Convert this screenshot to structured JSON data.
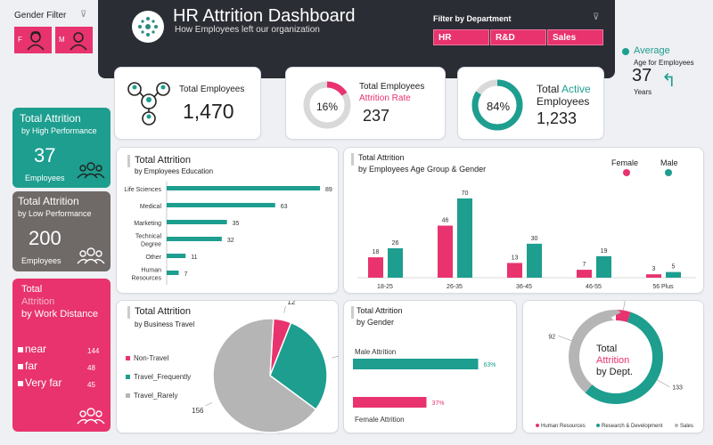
{
  "gender_filter": {
    "label": "Gender Filter",
    "female_letter": "F",
    "male_letter": "M"
  },
  "header": {
    "title": "HR Attrition Dashboard",
    "subtitle": "How Employees left our organization"
  },
  "dept_filter": {
    "label": "Filter by Department",
    "options": [
      "HR",
      "R&D",
      "Sales"
    ]
  },
  "average_age": {
    "label": "Average",
    "sublabel": "Age for Employees",
    "value": "37",
    "unit": "Years"
  },
  "kpis": {
    "total_employees": {
      "label": "Total Employees",
      "value": "1,470"
    },
    "attrition": {
      "label": "Total Employees",
      "label2": "Attrition Rate",
      "pct": "16%",
      "pct_value": 16,
      "value": "237"
    },
    "active": {
      "label_a": "Total",
      "label_b": "Active",
      "label_c": "Employees",
      "pct": "84%",
      "pct_value": 84,
      "value": "1,233"
    }
  },
  "high_perf": {
    "title": "Total Attrition",
    "subtitle": "by High Performance",
    "value": "37",
    "unit": "Employees"
  },
  "low_perf": {
    "title": "Total Attrition",
    "subtitle": "by Low Performance",
    "value": "200",
    "unit": "Employees"
  },
  "work_distance": {
    "title1": "Total",
    "title2": "Attrition",
    "title3": "by Work Distance",
    "items": [
      {
        "label": "near",
        "value": "144"
      },
      {
        "label": "far",
        "value": "48"
      },
      {
        "label": "Very far",
        "value": "45"
      }
    ]
  },
  "education": {
    "title": "Total Attrition",
    "subtitle": "by Employees Education",
    "chart_data": {
      "type": "bar",
      "categories": [
        "Life Sciences",
        "Medical",
        "Marketing",
        "Technical Degree",
        "Other",
        "Human Resources"
      ],
      "values": [
        89,
        63,
        35,
        32,
        11,
        7
      ]
    }
  },
  "age_gender": {
    "title": "Total Attrition",
    "subtitle": "by Employees Age Group & Gender",
    "legend": {
      "female": "Female",
      "male": "Male"
    },
    "chart_data": {
      "type": "bar",
      "categories": [
        "18-25",
        "26-35",
        "36-45",
        "46-55",
        "56 Plus"
      ],
      "series": [
        {
          "name": "Female",
          "values": [
            18,
            46,
            13,
            7,
            3
          ]
        },
        {
          "name": "Male",
          "values": [
            26,
            70,
            30,
            19,
            5
          ]
        }
      ]
    }
  },
  "travel": {
    "title": "Total Attrition",
    "subtitle": "by Business Travel",
    "chart_data": {
      "type": "pie",
      "categories": [
        "Non-Travel",
        "Travel_Frequently",
        "Travel_Rarely"
      ],
      "values": [
        12,
        69,
        156
      ]
    }
  },
  "gender": {
    "title": "Total Attrition",
    "subtitle": "by Gender",
    "chart_data": {
      "type": "bar",
      "categories": [
        "Male Attrition",
        "Female Attrition"
      ],
      "values": [
        63,
        37
      ],
      "labels": [
        "63%",
        "37%"
      ]
    }
  },
  "dept": {
    "center1": "Total",
    "center2": "Attrition",
    "center3": "by Dept.",
    "chart_data": {
      "type": "pie",
      "categories": [
        "Human Resources",
        "Research & Development",
        "Sales"
      ],
      "values": [
        12,
        133,
        92
      ]
    }
  },
  "colors": {
    "pink": "#e8336e",
    "teal": "#1d9e8f",
    "gray": "#b5b5b5",
    "dark": "#2b2d35"
  }
}
